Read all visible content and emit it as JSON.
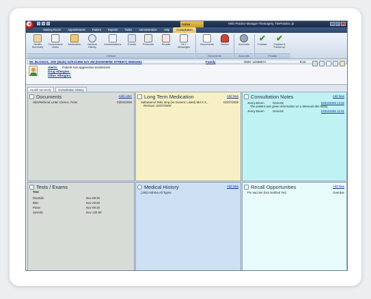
{
  "window": {
    "active_tag": "Active",
    "title": "Helix Practice Manager TheSurgery, ThePractice, jb"
  },
  "menu_tabs": [
    "Waiting Room",
    "Appointments",
    "Patient",
    "Reports",
    "Tasks",
    "Administration",
    "Help",
    "Consultation"
  ],
  "ribbon": {
    "clinical_buttons": [
      "Health Summary",
      "Consultation Notes",
      "Medication",
      "Medical History",
      "Immunisations",
      "Exams",
      "Protocols",
      "Recalls",
      "HL7 Messages"
    ],
    "documents_buttons": [
      "Documents",
      "Sketch"
    ],
    "accounts_buttons": [
      "Accounts"
    ],
    "finalise_buttons": [
      "Finalise",
      "Finalise & Follow-up"
    ],
    "groups": {
      "clinical": "Clinical",
      "documents": "Documents",
      "accounts": "Accounts",
      "finalise": "Finalise"
    }
  },
  "patient": {
    "header": "Mr. BLOGGS, JOE (Male) 02/01/1955 54Y 3M (NOWHERE STREET) 05551551",
    "family": "Family",
    "gms": "GMS: 1234567A",
    "time": "8:16",
    "alerts_label": "Alerts:",
    "alerts_text": "Patient has aggressive tendencies",
    "drug_allergies": "Drug Allergies:",
    "other_allergies": "Other Allergies:"
  },
  "subtabs": [
    "Health Summary",
    "Consultation History"
  ],
  "panels": {
    "documents": {
      "title": "Documents",
      "add": "Add Letter",
      "rows": [
        {
          "text": "Skin/Referral Letter Clerice, Peter",
          "date": "03/04/2009"
        }
      ]
    },
    "medication": {
      "title": "Long Term Medication",
      "add": "Add New",
      "rows": [
        {
          "text": "Salbutamol Tabs 3mg (so Generic Listed) Md X 3...",
          "date": "02/07/2009",
          "note": "Reissue: 02/07/2009"
        }
      ]
    },
    "consultation": {
      "title": "Consultation Notes",
      "add": "Add New",
      "rows": [
        {
          "who": "Jenny Breen",
          "type": "General",
          "date": "03/04/2009 13:32",
          "note": "The patient was given information on a lebecoid diet today."
        },
        {
          "who": "Jenny Breen",
          "type": "General",
          "date": "03/04/2009 12:01",
          "note": ""
        }
      ]
    },
    "tests": {
      "title": "Tests / Exams",
      "header": "Test",
      "rows": [
        {
          "name": "Diastolic",
          "date": "Nov 09:30"
        },
        {
          "name": "BMI",
          "date": "Nov 29:30"
        },
        {
          "name": "Pulse",
          "date": "Nov 09:30"
        },
        {
          "name": "Systolic",
          "date": "Nov 120.00"
        }
      ]
    },
    "history": {
      "title": "Medical History",
      "add": "Add New",
      "rows": [
        {
          "text": "(J45) Asthma All Types"
        }
      ]
    },
    "recall": {
      "title": "Recall Opportunities",
      "add": "Add New",
      "rows": [
        {
          "text": "Flu Vaccine (Not Notified Yet)",
          "status": "Overdue"
        }
      ]
    }
  },
  "colors": {
    "documents_bg": "#d8dcd7",
    "medication_bg": "#f6f0c4",
    "consultation_bg": "#bff3f3",
    "tests_bg": "#d8dcd7",
    "history_bg": "#ccdff3",
    "recall_bg": "#e8fbfb"
  }
}
